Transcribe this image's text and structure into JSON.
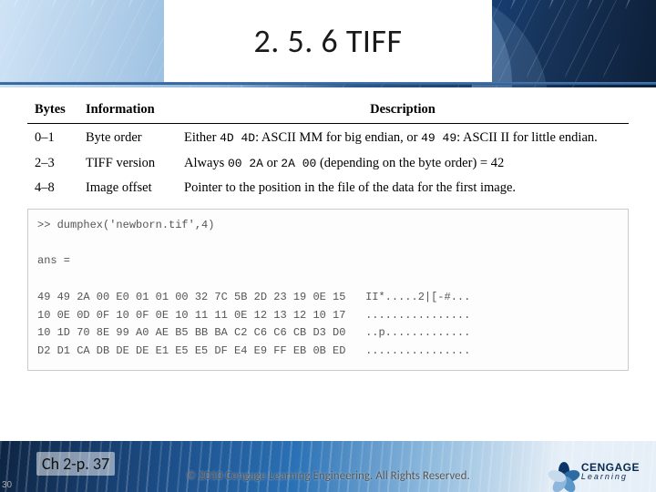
{
  "title": "2. 5. 6 TIFF",
  "table": {
    "headers": {
      "bytes": "Bytes",
      "info": "Information",
      "desc": "Description"
    },
    "rows": [
      {
        "bytes": "0–1",
        "info": "Byte order",
        "desc_pre": "Either ",
        "desc_code1": "4D 4D",
        "desc_mid": ": ASCII MM for big endian, or ",
        "desc_code2": "49 49",
        "desc_post": ": ASCII II for little endian."
      },
      {
        "bytes": "2–3",
        "info": "TIFF version",
        "desc_pre": "Always ",
        "desc_code1": "00 2A",
        "desc_mid": " or ",
        "desc_code2": "2A 00",
        "desc_post": " (depending on the byte order) = 42"
      },
      {
        "bytes": "4–8",
        "info": "Image offset",
        "desc_plain": "Pointer to the position in the file of the data for the first image."
      }
    ]
  },
  "hex": {
    "cmd": ">> dumphex('newborn.tif',4)",
    "ans": "ans =",
    "lines": [
      {
        "hex": "49 49 2A 00 E0 01 01 00 32 7C 5B 2D 23 19 0E 15",
        "ascii": "II*.....2|[-#..."
      },
      {
        "hex": "10 0E 0D 0F 10 0F 0E 10 11 11 0E 12 13 12 10 17",
        "ascii": "................"
      },
      {
        "hex": "10 1D 70 8E 99 A0 AE B5 BB BA C2 C6 C6 CB D3 D0",
        "ascii": "..p............."
      },
      {
        "hex": "D2 D1 CA DB DE DE E1 E5 E5 DF E4 E9 FF EB 0B ED",
        "ascii": "................"
      }
    ]
  },
  "footer": {
    "page_ref": "Ch 2-p. 37",
    "copyright": "© 2010 Cengage Learning Engineering. All Rights Reserved.",
    "logo_top": "CENGAGE",
    "logo_sub": "Learning"
  },
  "slide_number": "30"
}
